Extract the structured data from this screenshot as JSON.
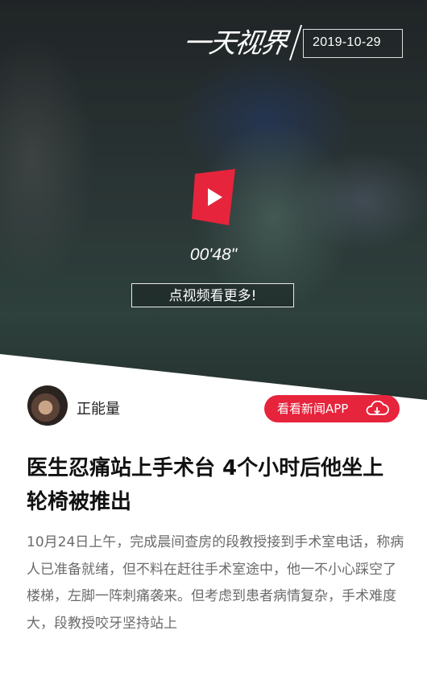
{
  "hero": {
    "brand_logo": "一天视界",
    "date": "2019-10-29",
    "duration": "00'48\"",
    "more_video_label": "点视频看更多!"
  },
  "author": {
    "name": "正能量"
  },
  "app_button": {
    "label": "看看新闻APP",
    "icon": "cloud-download-icon"
  },
  "article": {
    "title": "医生忍痛站上手术台 4个小时后他坐上轮椅被推出",
    "body": "10月24日上午，完成晨间查房的段教授接到手术室电话，称病人已准备就绪，但不料在赶往手术室途中，他一不小心踩空了楼梯，左脚一阵刺痛袭来。但考虑到患者病情复杂，手术难度大，段教授咬牙坚持站上"
  },
  "colors": {
    "accent": "#e6243c",
    "title_text": "#111111",
    "body_text": "#6b6b6b"
  }
}
